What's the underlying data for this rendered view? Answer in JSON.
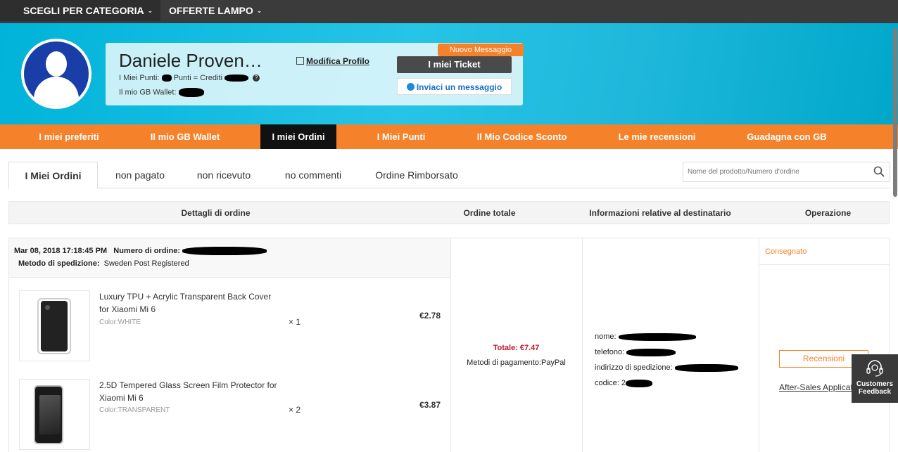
{
  "topbar": {
    "category": "SCEGLI PER CATEGORIA",
    "flash": "OFFERTE LAMPO"
  },
  "profile": {
    "name": "Daniele Proven…",
    "points_label": "I Miei Punti:",
    "points_eq": "Punti = Crediti",
    "wallet_label": "Il mio GB Wallet:",
    "edit": "Modifica Profilo",
    "ticket": "I miei Ticket",
    "new_message": "Nuovo Messaggio",
    "send_message": "Inviaci un messaggio"
  },
  "nav": [
    "I miei preferiti",
    "Il mio GB Wallet",
    "I miei Ordini",
    "I Miei Punti",
    "Il Mio Codice Sconto",
    "Le mie recensioni",
    "Guadagna con GB"
  ],
  "tabs": [
    "I Miei Ordini",
    "non pagato",
    "non ricevuto",
    "no commenti",
    "Ordine Rimborsato"
  ],
  "search": {
    "placeholder": "Nome del prodotto/Numero d'ordine"
  },
  "table_headers": [
    "Dettagli di ordine",
    "Ordine totale",
    "Informazioni relative al destinatario",
    "Operazione"
  ],
  "order": {
    "date": "Mar 08, 2018 17:18:45 PM",
    "number_label": "Numero di ordine:",
    "shipping_label": "Metodo di spedizione:",
    "shipping": "Sweden Post Registered",
    "products": [
      {
        "name": "Luxury TPU + Acrylic Transparent Back Cover for Xiaomi Mi 6",
        "color": "Color:WHITE",
        "qty": "× 1",
        "price": "€2.78"
      },
      {
        "name": "2.5D Tempered Glass Screen Film Protector for Xiaomi Mi 6",
        "color": "Color:TRANSPARENT",
        "qty": "× 2",
        "price": "€3.87"
      }
    ],
    "total": "Totale: €7.47",
    "payment": "Metodi di pagamento:PayPal",
    "recipient": {
      "name_label": "nome:",
      "phone_label": "telefono:",
      "address_label": "indirizzo di spedizione:",
      "code_label": "codice:",
      "code_partial": "2"
    },
    "status": "Consegnato",
    "review_button": "Recensioni",
    "after_sales": "After-Sales Application"
  },
  "feedback": {
    "line1": "Customers",
    "line2": "Feedback"
  }
}
